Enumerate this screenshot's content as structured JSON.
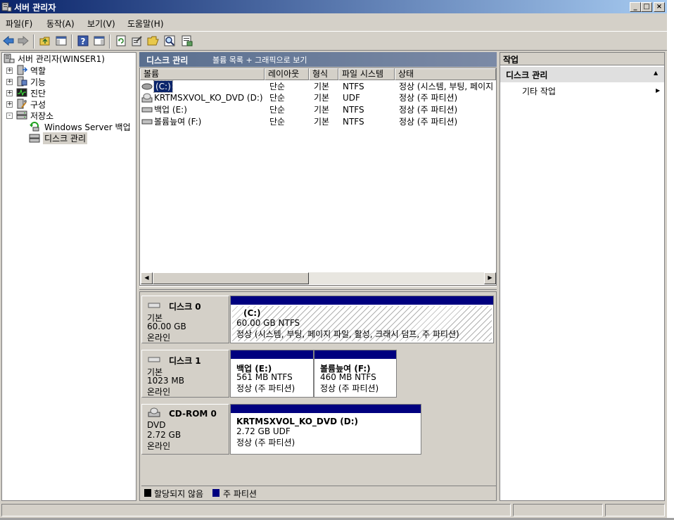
{
  "window": {
    "title": "서버 관리자",
    "min_label": "_",
    "max_label": "□",
    "close_label": "×"
  },
  "menubar": {
    "items": [
      "파일(F)",
      "동작(A)",
      "보기(V)",
      "도움말(H)"
    ]
  },
  "toolbar": {
    "icons": [
      "back-arrow-icon",
      "forward-arrow-icon",
      "up-folder-icon",
      "show-hide-tree-icon",
      "help-icon",
      "show-hide-action-icon",
      "refresh-icon",
      "properties-icon",
      "open-icon",
      "search-icon",
      "export-icon"
    ]
  },
  "tree": {
    "root": "서버 관리자(WINSER1)",
    "items": [
      {
        "label": "역할",
        "expander": "+"
      },
      {
        "label": "기능",
        "expander": "+"
      },
      {
        "label": "진단",
        "expander": "+"
      },
      {
        "label": "구성",
        "expander": "+"
      },
      {
        "label": "저장소",
        "expander": "-"
      }
    ],
    "children": [
      {
        "label": "Windows Server 백업"
      },
      {
        "label": "디스크 관리"
      }
    ]
  },
  "center": {
    "title": "디스크 관리",
    "subtitle": "볼륨 목록 + 그래픽으로 보기"
  },
  "volume_table": {
    "columns": [
      "볼륨",
      "레이아웃",
      "형식",
      "파일 시스템",
      "상태"
    ],
    "rows": [
      {
        "volume": "(C:)",
        "layout": "단순",
        "type": "기본",
        "fs": "NTFS",
        "status": "정상 (시스템, 부팅, 페이지"
      },
      {
        "volume": "KRTMSXVOL_KO_DVD (D:)",
        "layout": "단순",
        "type": "기본",
        "fs": "UDF",
        "status": "정상 (주 파티션)"
      },
      {
        "volume": "백업 (E:)",
        "layout": "단순",
        "type": "기본",
        "fs": "NTFS",
        "status": "정상 (주 파티션)"
      },
      {
        "volume": "볼륨늪여 (F:)",
        "layout": "단순",
        "type": "기본",
        "fs": "NTFS",
        "status": "정상 (주 파티션)"
      }
    ]
  },
  "scroll": {
    "left_arrow": "◀",
    "right_arrow": "▶"
  },
  "disks": [
    {
      "name": "디스크 0",
      "type": "기본",
      "size": "60.00 GB",
      "state": "온라인",
      "partitions": [
        {
          "name": "(C:)",
          "size_fs": "60.00 GB NTFS",
          "status": "정상 (시스템, 부팅, 페이지 파일, 활성, 크래시 덤프, 주 파티션)"
        }
      ]
    },
    {
      "name": "디스크 1",
      "type": "기본",
      "size": "1023 MB",
      "state": "온라인",
      "partitions": [
        {
          "name": "백업  (E:)",
          "size_fs": "561 MB NTFS",
          "status": "정상 (주 파티션)"
        },
        {
          "name": "볼륨늪여  (F:)",
          "size_fs": "460 MB NTFS",
          "status": "정상 (주 파티션)"
        }
      ]
    },
    {
      "name": "CD-ROM 0",
      "type": "DVD",
      "size": "2.72 GB",
      "state": "온라인",
      "partitions": [
        {
          "name": "KRTMSXVOL_KO_DVD  (D:)",
          "size_fs": "2.72 GB UDF",
          "status": "정상 (주 파티션)"
        }
      ]
    }
  ],
  "legend": {
    "unallocated": "할당되지 않음",
    "primary": "주 파티션",
    "unallocated_color": "#000000",
    "primary_color": "#00007f"
  },
  "actions": {
    "header": "작업",
    "section": "디스크 관리",
    "section_arrow": "▲",
    "items": [
      {
        "label": "기타 작업",
        "arrow": "▶"
      }
    ]
  },
  "colors": {
    "titlebar_start": "#0a246a",
    "titlebar_end": "#a6caf0",
    "selection": "#0a246a",
    "partition_bar": "#00007f"
  }
}
